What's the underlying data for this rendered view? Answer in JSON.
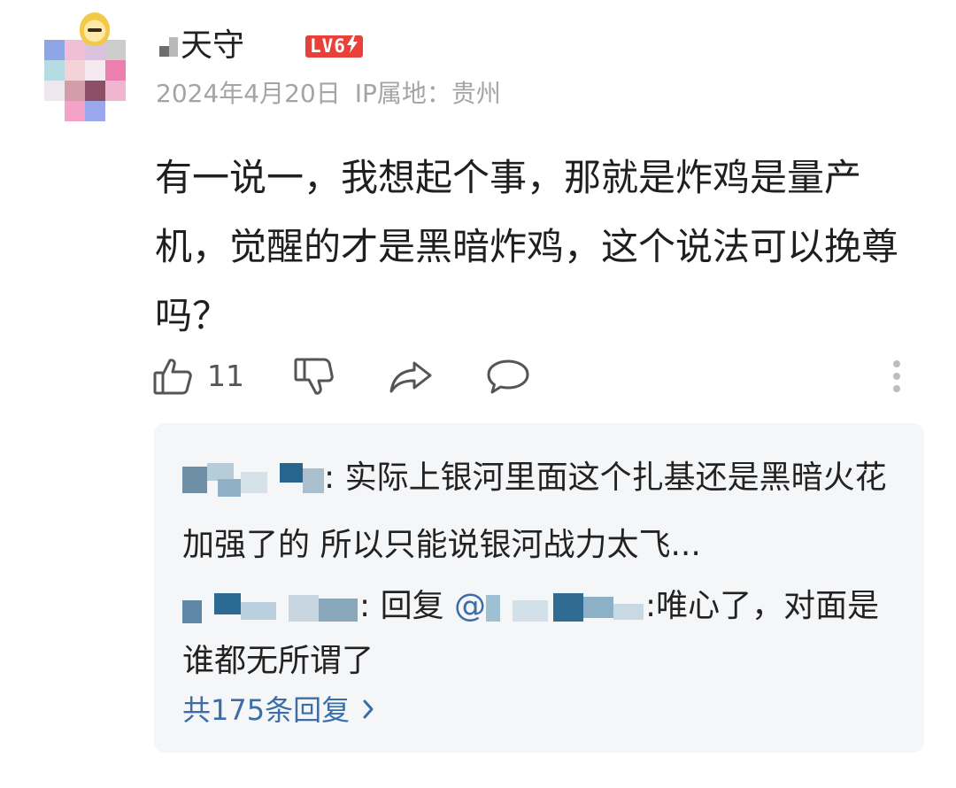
{
  "user": {
    "name": "天守",
    "level": "LV6",
    "date": "2024年4月20日",
    "ip_location": "IP属地：贵州"
  },
  "comment": {
    "text": "有一说一，我想起个事，那就是炸鸡是量产机，觉醒的才是黑暗炸鸡，这个说法可以挽尊吗？"
  },
  "actions": {
    "like_count": "11",
    "icons": [
      "thumbs-up-icon",
      "thumbs-down-icon",
      "share-icon",
      "comment-icon",
      "more-vertical-icon"
    ]
  },
  "replies": [
    {
      "text": ":  实际上银河里面这个扎基还是黑暗火花加强了的 所以只能说银河战力太飞..."
    },
    {
      "prefix": ": 回复 ",
      "mention": "@",
      "text": ":唯心了，对面是谁都无所谓了"
    }
  ],
  "reply_summary": "共175条回复",
  "colors": {
    "accent_link": "#3c6da6",
    "level_badge": "#e7413a",
    "meta_gray": "#a4a4a4",
    "reply_bg": "#f5f6f8"
  }
}
